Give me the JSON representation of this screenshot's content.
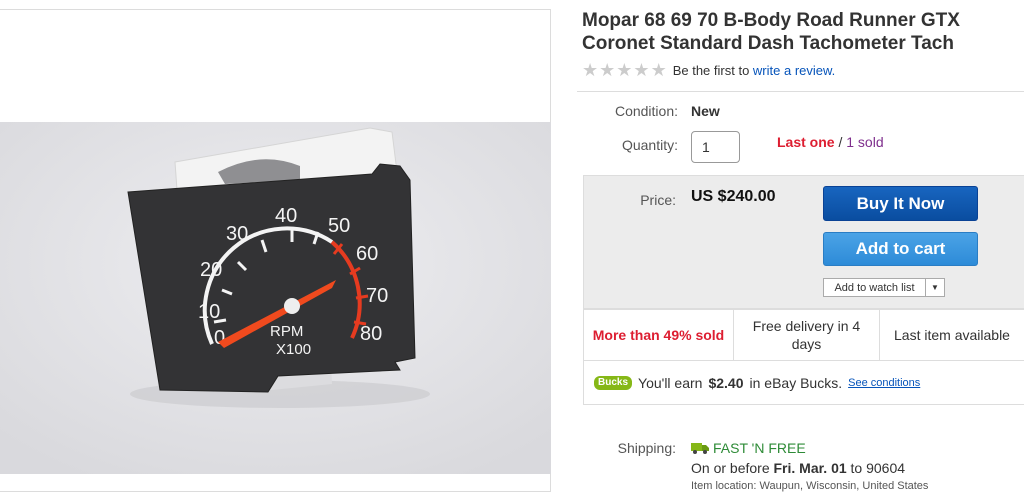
{
  "product": {
    "title_line1": "Mopar 68 69 70 B-Body Road Runner GTX",
    "title_line2": "Coronet Standard Dash Tachometer Tach",
    "image_alt": "Black tachometer gauge RPM X100"
  },
  "gauge": {
    "ticks": [
      "0",
      "10",
      "20",
      "30",
      "40",
      "50",
      "60",
      "70",
      "80"
    ],
    "rpm_label": "RPM",
    "x100_label": "X100"
  },
  "rating": {
    "stars_filled": 0,
    "stars_total": 5,
    "prefix": "Be the first to",
    "link": "write a review."
  },
  "condition": {
    "label": "Condition:",
    "value": "New"
  },
  "quantity": {
    "label": "Quantity:",
    "value": "1",
    "last_one": "Last one",
    "separator": " / ",
    "sold": "1 sold"
  },
  "price": {
    "label": "Price:",
    "value": "US $240.00"
  },
  "buttons": {
    "buy_now": "Buy It Now",
    "add_to_cart": "Add to cart",
    "watch_list": "Add to watch list"
  },
  "signals": {
    "sold_percent": "More than 49% sold",
    "delivery": "Free delivery in 4 days",
    "last_item": "Last item available"
  },
  "bucks": {
    "badge": "Bucks",
    "text_prefix": "You'll earn",
    "amount": "$2.40",
    "text_suffix": "in eBay Bucks.",
    "conditions_link": "See conditions"
  },
  "shipping": {
    "label": "Shipping:",
    "method": "FAST 'N FREE",
    "date_prefix": "On or before",
    "date": "Fri. Mar. 01",
    "to_zip": "to 90604",
    "location": "Item location:  Waupun, Wisconsin, United States"
  },
  "colors": {
    "link": "#0654ba",
    "alert_red": "#dd1e31",
    "buy_blue": "#0a4da0",
    "cart_blue": "#2d8bd8",
    "free_green": "#2e8b37",
    "bucks_green": "#86b817"
  }
}
